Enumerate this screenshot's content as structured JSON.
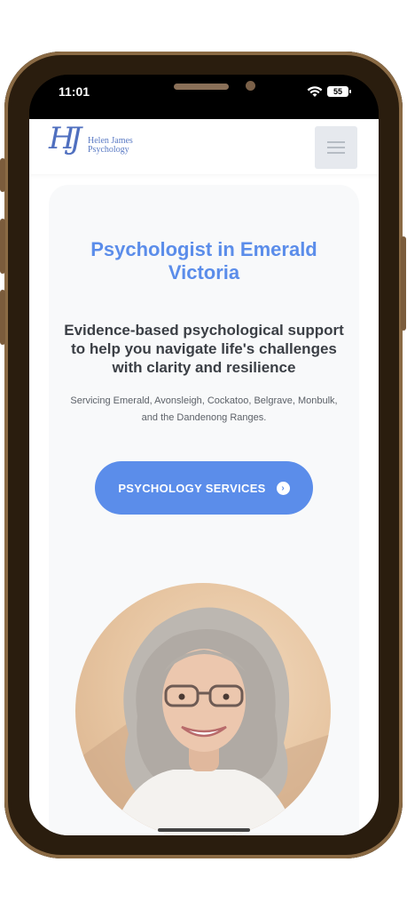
{
  "status": {
    "time": "11:01",
    "battery": "55"
  },
  "brand": {
    "monogram": "HJ",
    "line1": "Helen James",
    "line2": "Psychology"
  },
  "hero": {
    "title_line1": "Psychologist in Emerald",
    "title_line2": "Victoria",
    "sub_line1": "Evidence-based psychological support",
    "sub_line2": "to help you navigate life's challenges",
    "sub_line3": "with clarity and resilience",
    "areas_line1": "Servicing Emerald, Avonsleigh, Cockatoo, Belgrave, Monbulk,",
    "areas_line2": "and the Dandenong Ranges.",
    "cta_label": "PSYCHOLOGY SERVICES",
    "cta_icon": "chevron-circle-right-icon"
  },
  "colors": {
    "accent": "#5b8dea",
    "frame": "#2a1d0e",
    "card": "#f8f9fa"
  }
}
